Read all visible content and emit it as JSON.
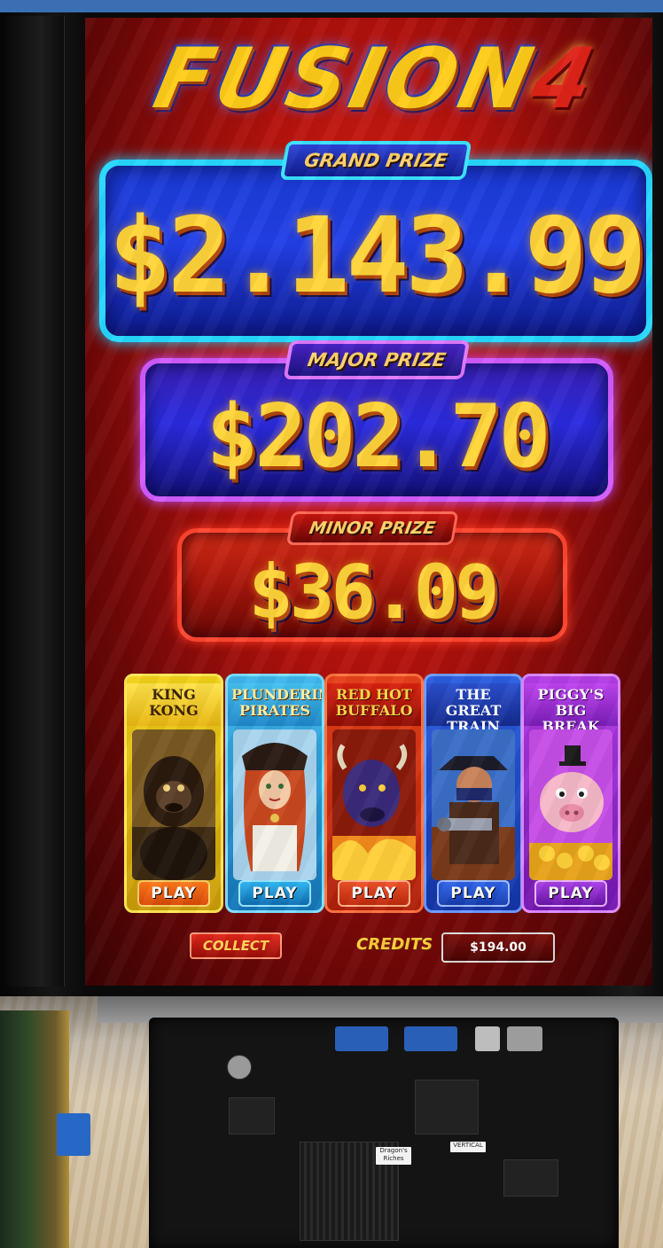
{
  "logo": {
    "text": "FUSION",
    "number": "4"
  },
  "jackpots": {
    "grand": {
      "label": "GRAND PRIZE",
      "amount": "$2.143.99",
      "color": "#26d8ff"
    },
    "major": {
      "label": "MAJOR PRIZE",
      "amount": "$202.70",
      "color": "#d25cff"
    },
    "minor": {
      "label": "MINOR PRIZE",
      "amount": "$36.09",
      "color": "#ff4630"
    }
  },
  "games": [
    {
      "title": "KING KONG",
      "play": "PLAY",
      "icon": "gorilla-icon"
    },
    {
      "title": "PLUNDERIN' PIRATES",
      "play": "PLAY",
      "icon": "pirate-icon"
    },
    {
      "title": "RED HOT BUFFALO",
      "play": "PLAY",
      "icon": "buffalo-icon"
    },
    {
      "title": "THE GREAT TRAIN ROBBERY",
      "play": "PLAY",
      "icon": "train-robber-icon"
    },
    {
      "title": "PIGGY'S BIG BREAK",
      "play": "PLAY",
      "icon": "pig-icon"
    }
  ],
  "controls": {
    "collect": "COLLECT",
    "credits_label": "CREDITS",
    "credits_value": "$194.00"
  },
  "board_labels": {
    "tag1": "Dragon's Riches",
    "tag2": "VERTICAL"
  }
}
